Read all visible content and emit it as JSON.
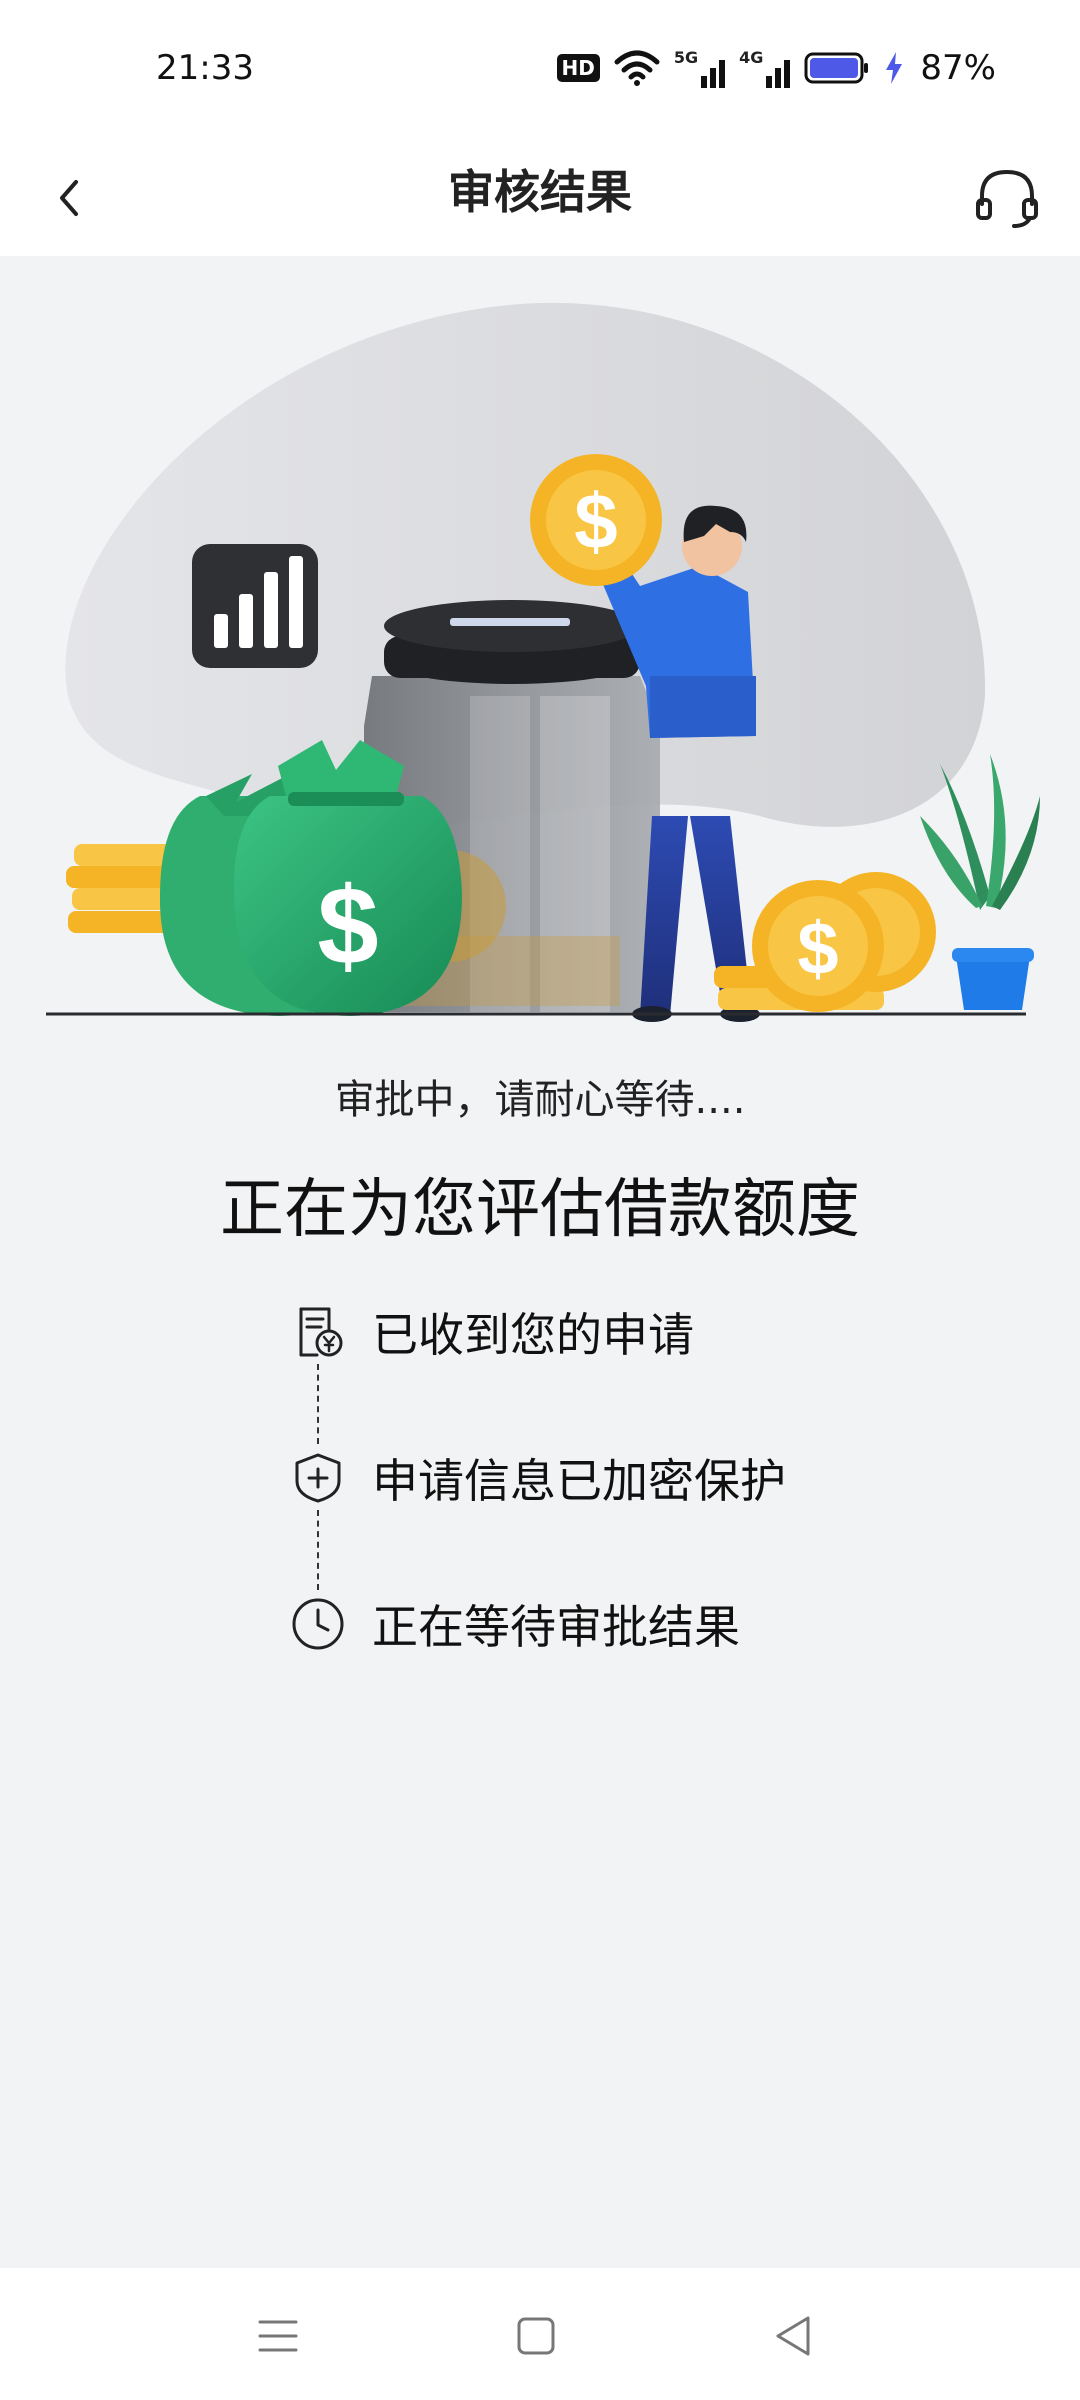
{
  "status_bar": {
    "time": "21:33",
    "hd_badge": "HD",
    "net_5g": "5G",
    "net_4g": "4G",
    "battery": "87%",
    "icons": [
      "hd-icon",
      "wifi-icon",
      "signal-5g-icon",
      "signal-4g-icon",
      "battery-icon",
      "charging-icon"
    ]
  },
  "header": {
    "title": "审核结果",
    "back_icon": "chevron-left-icon",
    "support_icon": "headset-icon"
  },
  "hero": {
    "coin_symbol": "$",
    "bag_symbol": "$",
    "icons": [
      "bar-chart-icon",
      "money-bag-icon",
      "coin-icon",
      "jar-icon",
      "plant-icon"
    ]
  },
  "status": {
    "subtitle": "审批中，请耐心等待....",
    "title": "正在为您评估借款额度"
  },
  "steps": [
    {
      "label": "已收到您的申请",
      "icon": "document-yen-icon"
    },
    {
      "label": "申请信息已加密保护",
      "icon": "shield-plus-icon"
    },
    {
      "label": "正在等待审批结果",
      "icon": "clock-icon"
    }
  ],
  "system_nav": {
    "icons": [
      "menu-icon",
      "home-square-icon",
      "back-triangle-icon"
    ]
  },
  "colors": {
    "background": "#f2f3f5",
    "coin": "#f5b425",
    "bag": "#22a56b",
    "person": "#2f6fe4",
    "battery": "#4f59e8"
  }
}
